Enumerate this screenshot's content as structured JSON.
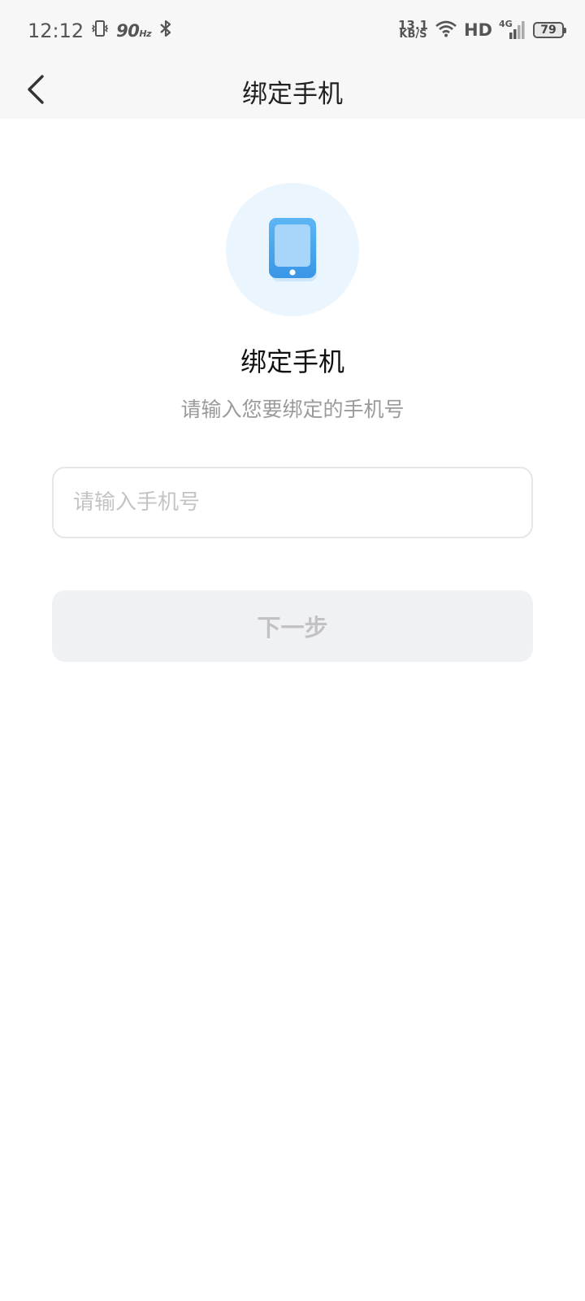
{
  "status_bar": {
    "time": "12:12",
    "refresh_rate": "90",
    "refresh_unit": "Hz",
    "net_speed_value": "13.1",
    "net_speed_unit": "KB/S",
    "hd_label": "HD",
    "network_type": "4G",
    "battery_level": "79"
  },
  "nav": {
    "title": "绑定手机"
  },
  "main": {
    "heading": "绑定手机",
    "subheading": "请输入您要绑定的手机号",
    "phone_input": {
      "value": "",
      "placeholder": "请输入手机号"
    },
    "next_button_label": "下一步"
  },
  "colors": {
    "hero_circle_bg": "#eaf5fe",
    "phone_icon_blue": "#4aa8f0",
    "button_disabled_bg": "#f0f1f5",
    "button_disabled_text": "#c2c2c2"
  },
  "icons": {
    "back": "chevron-left-icon",
    "hero": "smartphone-icon"
  }
}
